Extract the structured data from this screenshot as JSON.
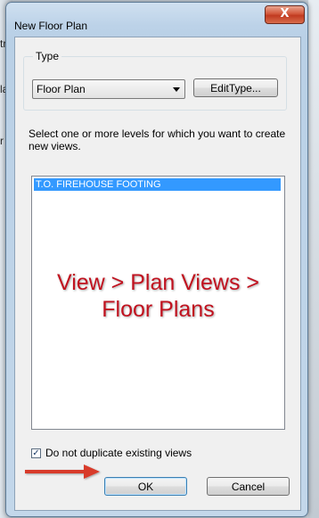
{
  "background": {
    "fragments": [
      "tr",
      "la",
      "r"
    ]
  },
  "dialog": {
    "title": "New Floor Plan",
    "close_label": "X",
    "type_group": {
      "legend": "Type",
      "selected": "Floor Plan",
      "edit_type_label": "EditType..."
    },
    "instruction": "Select one or more levels for which you want to create new views.",
    "levels": [
      "T.O. FIREHOUSE FOOTING"
    ],
    "annotation": [
      "View > Plan Views >",
      "Floor Plans"
    ],
    "duplicate_checkbox": {
      "label": "Do not duplicate existing views",
      "checked": true,
      "mark": "✓"
    },
    "ok_label": "OK",
    "cancel_label": "Cancel"
  },
  "colors": {
    "annotation_red": "#c1121f",
    "selection_blue": "#3399ff",
    "arrow_red": "#d83a2a"
  }
}
